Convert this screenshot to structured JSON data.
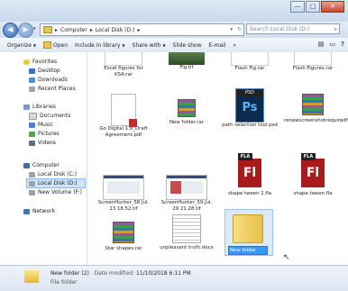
{
  "window": {
    "minimize": "—",
    "maximize": "□",
    "close": "✕"
  },
  "address": {
    "segments": [
      "Computer",
      "▸",
      "Local Disk (D:)",
      "▸"
    ],
    "search_placeholder": "Search Local Disk (D:)"
  },
  "toolbar": {
    "organize": "Organize",
    "open": "Open",
    "include": "Include in library",
    "share": "Share with",
    "slideshow": "Slide show",
    "email": "E-mail",
    "more": "»"
  },
  "nav": {
    "favorites": "Favorites",
    "desktop": "Desktop",
    "downloads": "Downloads",
    "recent": "Recent Places",
    "libraries": "Libraries",
    "documents": "Documents",
    "music": "Music",
    "pictures": "Pictures",
    "videos": "Videos",
    "computer": "Computer",
    "local_c": "Local Disk (C:)",
    "local_d": "Local Disk (D:)",
    "new_volume": "New Volume (F:)",
    "network": "Network"
  },
  "files": {
    "excel_figures": "Excel figures for KSA.rar",
    "fig_tif": "Fig.tif",
    "flash_fig": "Flash Fig.rar",
    "flash_figures": "Flash Figures.rar",
    "go_digital": "Go Digital 1.8_Draft Agreement.pdf",
    "new_folder_rar": "New folder.rar",
    "path_selection": "path selection tool.psd",
    "renew_screenshot": "renewscreenshotrequiredforpdfcopy.zip",
    "screenhunter1": "ScreenHunter_58 Jul. 13 18.52.tif",
    "screenhunter2": "ScreenHunter_59 Jul. 29 21.28.tif",
    "shape_tween2": "shape tween 2.fla",
    "shape_tween": "shape tween.fla",
    "star_shapes": "Star shapes.rar",
    "unpleasant": "unpleasant truth.docx",
    "new_folder_edit": "New folder"
  },
  "icons": {
    "psd": "PSD",
    "psd_glyph": "Ps",
    "fla": "FLA",
    "fla_glyph": "Fl"
  },
  "status": {
    "name": "New folder (2)",
    "date_label": "Date modified:",
    "date_value": "11/10/2018 6:11 PM",
    "type": "File folder"
  }
}
